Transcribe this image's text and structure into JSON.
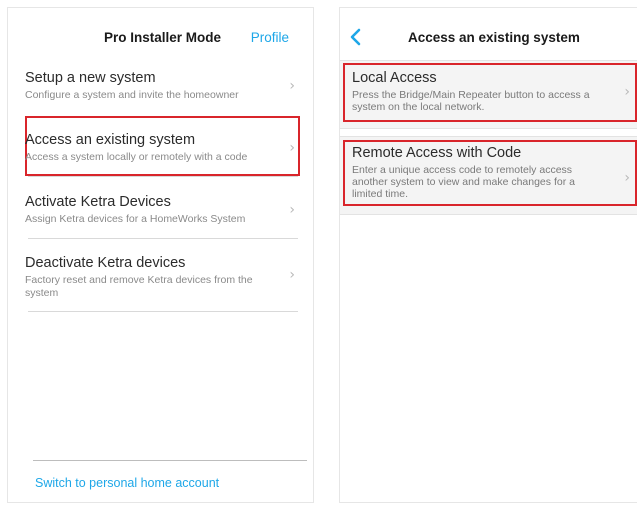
{
  "left_screen": {
    "header": {
      "title": "Pro Installer Mode",
      "action_label": "Profile"
    },
    "items": [
      {
        "title": "Setup a new system",
        "subtitle": "Configure a system and invite the homeowner",
        "highlighted": false
      },
      {
        "title": "Access an existing system",
        "subtitle": "Access a system locally or remotely with a code",
        "highlighted": true
      },
      {
        "title": "Activate Ketra Devices",
        "subtitle": "Assign Ketra devices for a HomeWorks System",
        "highlighted": false
      },
      {
        "title": "Deactivate Ketra devices",
        "subtitle": "Factory reset and remove Ketra devices from the system",
        "highlighted": false
      }
    ],
    "footer_link": "Switch to personal home account"
  },
  "right_screen": {
    "header": {
      "title": "Access an existing system",
      "back_icon": "chevron-left-icon"
    },
    "items": [
      {
        "title": "Local Access",
        "subtitle": "Press the Bridge/Main Repeater button to access a system on the local network.",
        "highlighted": true
      },
      {
        "title": "Remote Access with Code",
        "subtitle": "Enter a unique access code to remotely access another system to view and make changes for a limited time.",
        "highlighted": true
      }
    ]
  },
  "colors": {
    "accent": "#1ea7e8",
    "highlight": "#d9252b",
    "chevron": "#b9b9b9"
  },
  "icons": {
    "chevron_right": "›"
  }
}
